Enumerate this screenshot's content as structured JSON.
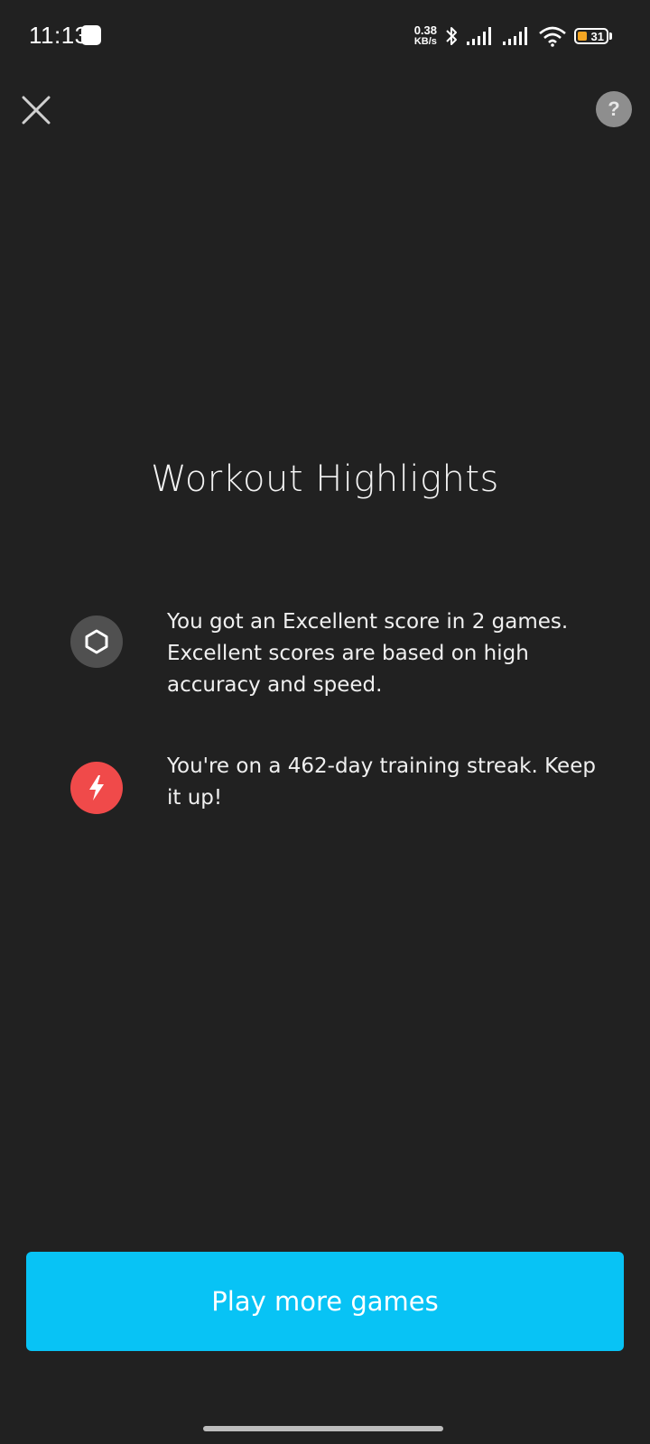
{
  "status_bar": {
    "time": "11:13",
    "net_speed_value": "0.38",
    "net_speed_unit": "KB/s",
    "battery_level": "31",
    "icons": [
      "app-notification-icon",
      "bluetooth-icon",
      "signal-icon",
      "signal-icon",
      "wifi-icon",
      "battery-icon"
    ]
  },
  "header": {
    "close_icon": "close-icon",
    "help_label": "?"
  },
  "title": "Workout Highlights",
  "highlights": [
    {
      "icon": "hexagon-icon",
      "text": "You got an Excellent score in 2 games. Excellent scores are based on high accuracy and speed."
    },
    {
      "icon": "lightning-icon",
      "text": "You're on a 462-day training streak. Keep it up!"
    }
  ],
  "play_button_label": "Play more games",
  "colors": {
    "background": "#212121",
    "accent": "#08c3f5",
    "streak": "#f04a4a",
    "score_icon_bg": "#505050"
  }
}
